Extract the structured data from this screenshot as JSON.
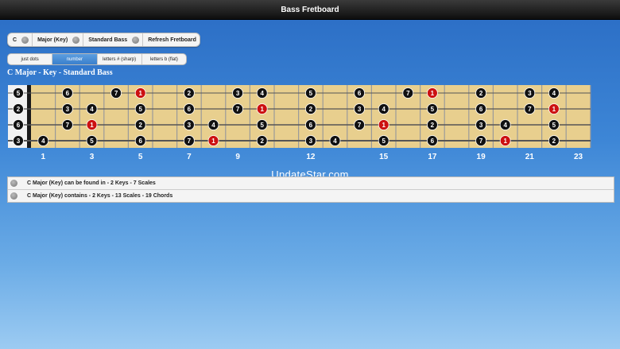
{
  "window": {
    "title": "Bass Fretboard"
  },
  "selectors": [
    {
      "label": "C"
    },
    {
      "label": "Major (Key)"
    },
    {
      "label": "Standard Bass"
    },
    {
      "label": "Refresh Fretboard"
    }
  ],
  "display_tabs": [
    {
      "label": "just dots",
      "active": false
    },
    {
      "label": "number",
      "active": true
    },
    {
      "label": "letters # (sharp)",
      "active": false
    },
    {
      "label": "letters b (flat)",
      "active": false
    }
  ],
  "heading": "C Major - Key - Standard Bass",
  "fretboard": {
    "fret_count": 23,
    "fret_markers": [
      "1",
      "3",
      "5",
      "7",
      "9",
      "12",
      "15",
      "17",
      "19",
      "21",
      "23"
    ],
    "marker_frets": [
      1,
      3,
      5,
      7,
      9,
      12,
      15,
      17,
      19,
      21,
      23
    ],
    "colors": {
      "wood": "#e8cf8e",
      "root": "#cc1111",
      "note": "#111111",
      "nut": "#1a1a1a"
    },
    "strings": [
      {
        "open": "5",
        "notes": [
          [
            2,
            "6"
          ],
          [
            4,
            "7"
          ],
          [
            5,
            "1"
          ],
          [
            7,
            "2"
          ],
          [
            9,
            "3"
          ],
          [
            10,
            "4"
          ],
          [
            12,
            "5"
          ],
          [
            14,
            "6"
          ],
          [
            16,
            "7"
          ],
          [
            17,
            "1"
          ],
          [
            19,
            "2"
          ],
          [
            21,
            "3"
          ],
          [
            22,
            "4"
          ]
        ]
      },
      {
        "open": "2",
        "notes": [
          [
            2,
            "3"
          ],
          [
            3,
            "4"
          ],
          [
            5,
            "5"
          ],
          [
            7,
            "6"
          ],
          [
            9,
            "7"
          ],
          [
            10,
            "1"
          ],
          [
            12,
            "2"
          ],
          [
            14,
            "3"
          ],
          [
            15,
            "4"
          ],
          [
            17,
            "5"
          ],
          [
            19,
            "6"
          ],
          [
            21,
            "7"
          ],
          [
            22,
            "1"
          ]
        ]
      },
      {
        "open": "6",
        "notes": [
          [
            2,
            "7"
          ],
          [
            3,
            "1"
          ],
          [
            5,
            "2"
          ],
          [
            7,
            "3"
          ],
          [
            8,
            "4"
          ],
          [
            10,
            "5"
          ],
          [
            12,
            "6"
          ],
          [
            14,
            "7"
          ],
          [
            15,
            "1"
          ],
          [
            17,
            "2"
          ],
          [
            19,
            "3"
          ],
          [
            20,
            "4"
          ],
          [
            22,
            "5"
          ]
        ]
      },
      {
        "open": "3",
        "notes": [
          [
            1,
            "4"
          ],
          [
            3,
            "5"
          ],
          [
            5,
            "6"
          ],
          [
            7,
            "7"
          ],
          [
            8,
            "1"
          ],
          [
            10,
            "2"
          ],
          [
            12,
            "3"
          ],
          [
            13,
            "4"
          ],
          [
            15,
            "5"
          ],
          [
            17,
            "6"
          ],
          [
            19,
            "7"
          ],
          [
            20,
            "1"
          ],
          [
            22,
            "2"
          ]
        ]
      }
    ]
  },
  "watermark": "UpdateStar.com",
  "info_rows": [
    {
      "text": "C Major (Key) can be found in - 2 Keys - 7 Scales"
    },
    {
      "text": "C Major (Key) contains - 2 Keys - 13 Scales - 19 Chords"
    }
  ]
}
